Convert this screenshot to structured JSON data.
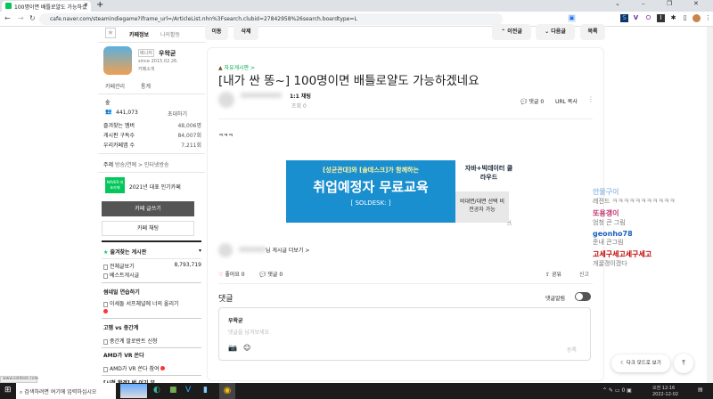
{
  "browser": {
    "tab_title": "100명이면 배틀로얄도 가능하겠",
    "url": "cafe.naver.com/steamindiegame?iframe_url=/ArticleList.nhn%3Fsearch.clubid=27842958%26search.boardtype=L",
    "status_url": "www.soldesk.com"
  },
  "sidebar": {
    "tab_info": "카페정보",
    "tab_activity": "나의활동",
    "manager_badge": "매니저",
    "manager_name": "우왁굳",
    "since": "since 2015.02.26.",
    "cafe_intro": "카페소개",
    "manage": "카페관리",
    "stats": "통계",
    "level": "숲",
    "members": "441,073",
    "invite": "초대하기",
    "stats_rows": [
      {
        "label": "즐겨찾는 멤버",
        "value": "48,006명"
      },
      {
        "label": "게시판 구독수",
        "value": "84,007회"
      },
      {
        "label": "우리카페앱 수",
        "value": "7,211회"
      }
    ],
    "topic_label": "주제",
    "topic": "방송/연예 > 인터넷방송",
    "naver_badge": "NAVER 대표카페",
    "award": "2021년 대표 인기카페",
    "write_btn": "카페 글쓰기",
    "chat_btn": "카페 채팅",
    "fav_boards": "즐겨찾는 게시판",
    "all_posts": "전체글보기",
    "all_count": "8,793,719",
    "best_posts": "베스트게시글",
    "sections": [
      {
        "title": "썸네일 연습하기",
        "item": "이세돌 서프체널에 너의 올리기"
      },
      {
        "title": "고멤 vs 중간계",
        "item": "중간계 발로란트 신청"
      },
      {
        "title": "AMD가 VR 쏜다",
        "item": "AMD가 VR 쏜다 참여"
      },
      {
        "title": "[시청 환경] 벗 이기 부..."
      }
    ]
  },
  "toolbar": {
    "move": "이동",
    "delete": "삭제",
    "prev": "이전글",
    "next": "다음글",
    "list": "목록"
  },
  "article": {
    "board": "자유게시판 >",
    "title": "[내가 싼 똥~] 100명이면 배틀로얄도 가능하겠네요",
    "chat_label": "1:1 채팅",
    "views": "조회 0",
    "comments": "댓글 0",
    "url_copy": "URL 복사",
    "body": "ㅋㅋㅋ",
    "more_posts": "님 게시글 더보기 >",
    "likes": "좋아요 0",
    "comment_count": "댓글 0",
    "share": "공유",
    "report": "신고",
    "comment_header": "댓글",
    "comment_alarm": "댓글알림",
    "commenter": "우왁굳",
    "comment_placeholder": "댓글을 남겨보세요",
    "submit": "등록"
  },
  "banner": {
    "line1": "[성균관대]와 [솔데스크]가 함께하는",
    "line2": "취업예정자 무료교육",
    "brand": "[ SOLDESK: ]",
    "right1": "자바+빅데이터 클라우드",
    "right2": "비대면/대면 선택 비전공자 가능"
  },
  "chat": [
    {
      "name": "안물구이",
      "msg": "레전드 ㅋㅋㅋㅋㅋㅋㅋㅋㅋㅋㅋ",
      "color": "#9cc3e6"
    },
    {
      "name": "또용갱이",
      "msg": "엄청 큰 그림",
      "color": "#c0306a"
    },
    {
      "name": "geonho78",
      "msg": "준내 큰그림",
      "color": "#1a5fc0"
    },
    {
      "name": "고세구세고세구세고",
      "msg": "개꿀갱이겠다",
      "color": "#c00000"
    }
  ],
  "floating": {
    "dark_mode": "다크 모드로 보기"
  },
  "taskbar": {
    "search": "검색하려면 여기에 입력하십시오",
    "time": "오전 12:16",
    "date": "2022-12-02"
  }
}
